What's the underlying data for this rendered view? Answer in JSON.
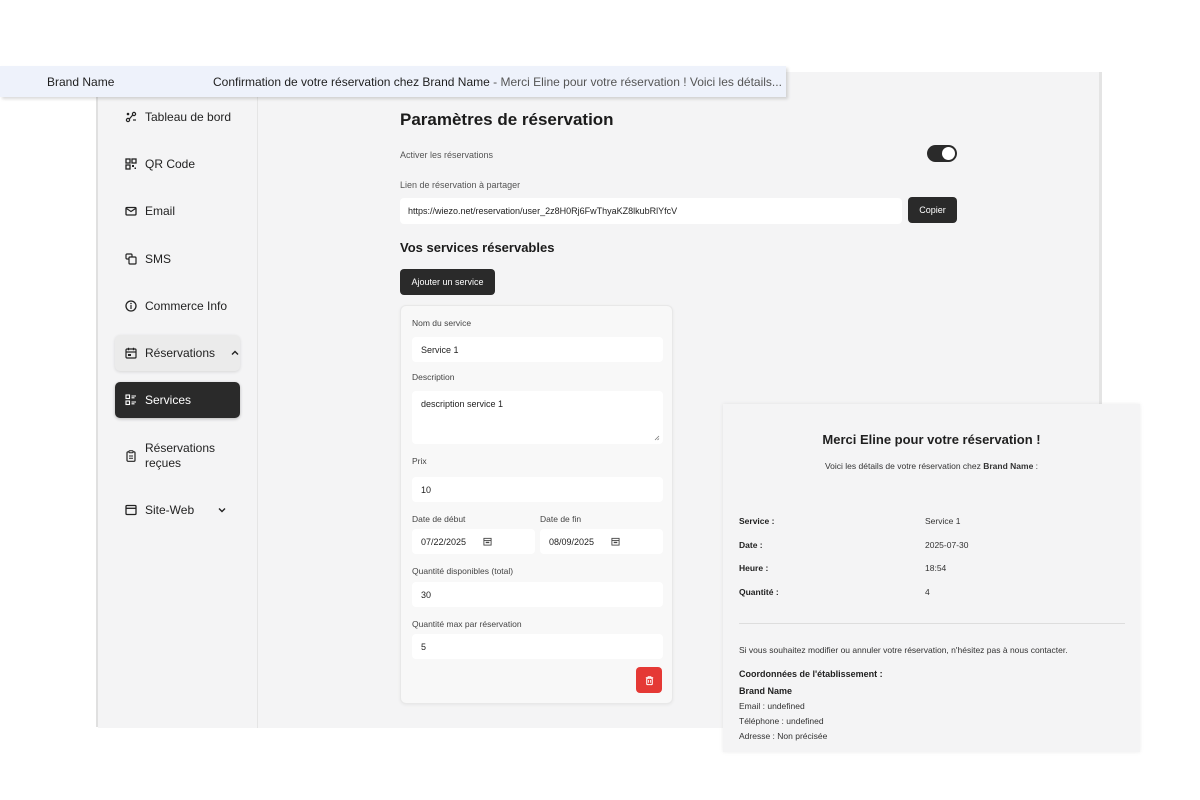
{
  "banner": {
    "sender": "Brand Name",
    "subject": "Confirmation de votre réservation chez Brand Name",
    "preview": " - Merci Eline pour votre réservation ! Voici les détails..."
  },
  "sidebar": {
    "items": [
      {
        "label": "Tableau de bord",
        "icon": "dashboard-icon"
      },
      {
        "label": "QR Code",
        "icon": "qr-code-icon"
      },
      {
        "label": "Email",
        "icon": "mail-icon"
      },
      {
        "label": "SMS",
        "icon": "sms-icon"
      },
      {
        "label": "Commerce Info",
        "icon": "info-icon"
      },
      {
        "label": "Réservations",
        "icon": "calendar-icon"
      },
      {
        "label": "Services",
        "icon": "services-icon"
      },
      {
        "label": "Réservations reçues",
        "icon": "clipboard-icon"
      },
      {
        "label": "Site-Web",
        "icon": "browser-icon"
      }
    ]
  },
  "settings": {
    "title": "Paramètres de réservation",
    "enable_label": "Activer les réservations",
    "enabled": true,
    "link_label": "Lien de réservation à partager",
    "link_value": "https://wiezo.net/reservation/user_2z8H0Rj6FwThyaKZ8lkubRlYfcV",
    "copy_button": "Copier"
  },
  "services": {
    "title": "Vos services réservables",
    "add_button": "Ajouter un service",
    "card": {
      "name_label": "Nom du service",
      "name_value": "Service 1",
      "description_label": "Description",
      "description_value": "description service 1",
      "price_label": "Prix",
      "price_value": "10",
      "start_label": "Date de début",
      "start_value": "07/22/2025",
      "end_label": "Date de fin",
      "end_value": "08/09/2025",
      "qty_total_label": "Quantité disponibles (total)",
      "qty_total_value": "30",
      "qty_max_label": "Quantité max par réservation",
      "qty_max_value": "5"
    }
  },
  "email": {
    "heading": "Merci Eline pour votre réservation !",
    "sub_prefix": "Voici les détails de votre réservation chez ",
    "sub_brand": "Brand Name",
    "sub_suffix": " :",
    "details": [
      {
        "key": "Service :",
        "value": "Service 1"
      },
      {
        "key": "Date :",
        "value": "2025-07-30"
      },
      {
        "key": "Heure :",
        "value": "18:54"
      },
      {
        "key": "Quantité :",
        "value": "4"
      }
    ],
    "contact_note": "Si vous souhaitez modifier ou annuler votre réservation, n'hésitez pas à nous contacter.",
    "coords_title": "Coordonnées de l'établissement :",
    "brand": "Brand Name",
    "email_line": "Email : undefined",
    "phone_line": "Téléphone : undefined",
    "address_line": "Adresse : Non précisée"
  },
  "colors": {
    "accent_dark": "#2a2a2a",
    "danger": "#e53935",
    "banner_bg": "#eef2fb"
  }
}
